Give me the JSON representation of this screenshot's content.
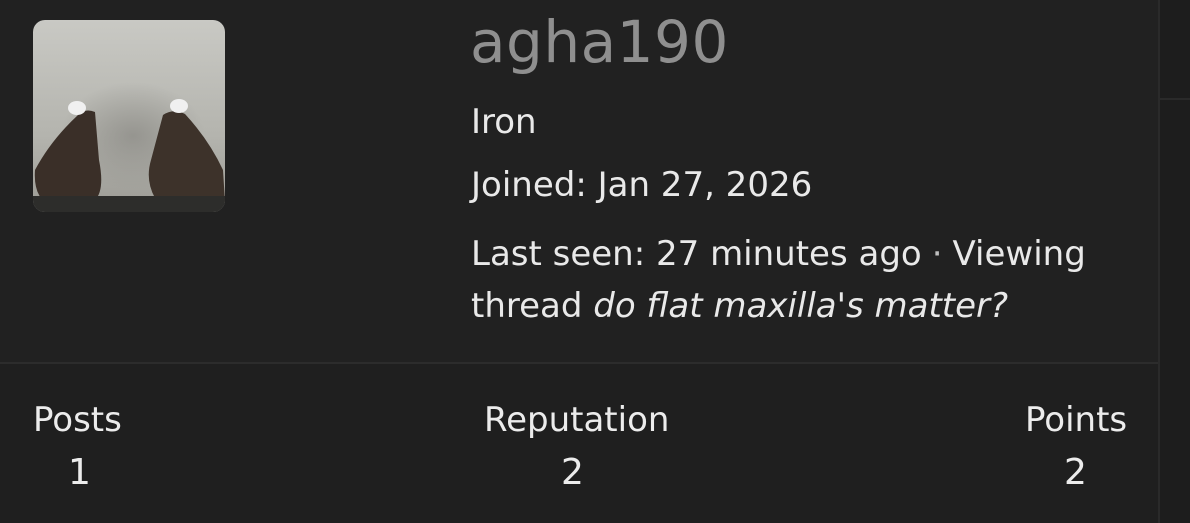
{
  "profile": {
    "username": "agha190",
    "rank": "Iron",
    "joined": "Joined: Jan 27, 2026",
    "last_seen": "Last seen: 27 minutes ago",
    "separator": "·",
    "activity_prefix": "Viewing thread",
    "activity_thread": "do flat maxilla's matter?"
  },
  "stats": {
    "posts_label": "Posts",
    "posts_value": "1",
    "reputation_label": "Reputation",
    "reputation_value": "2",
    "points_label": "Points",
    "points_value": "2"
  },
  "colors": {
    "card_bg": "#212121",
    "username": "#8f8f8f",
    "text": "#e9e9e9"
  }
}
